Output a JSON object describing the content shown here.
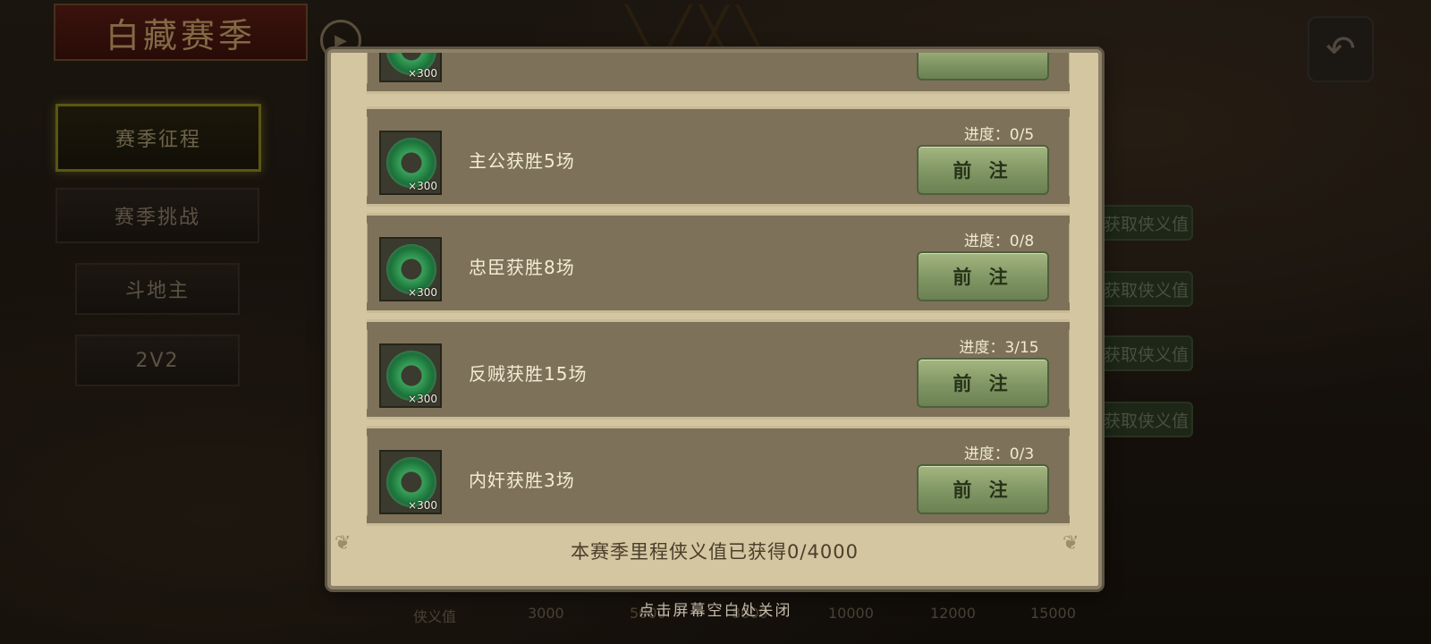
{
  "background": {
    "season_title": "白藏赛季",
    "nav": [
      {
        "label": "赛季征程",
        "active": true
      },
      {
        "label": "赛季挑战",
        "active": false
      },
      {
        "label": "斗地主",
        "active": false
      },
      {
        "label": "2V2",
        "active": false
      }
    ],
    "side_buttons": [
      "获取侠义值",
      "获取侠义值",
      "获取侠义值",
      "获取侠义值"
    ],
    "milestone_label": "侠义值",
    "milestones": [
      "3000",
      "5000",
      "8000",
      "10000",
      "12000",
      "15000"
    ]
  },
  "modal": {
    "tasks": [
      {
        "name": "",
        "reward_qty": "×300",
        "progress": "",
        "button": ""
      },
      {
        "name": "主公获胜5场",
        "reward_qty": "×300",
        "progress": "进度：0/5",
        "button": "前 注"
      },
      {
        "name": "忠臣获胜8场",
        "reward_qty": "×300",
        "progress": "进度：0/8",
        "button": "前 注"
      },
      {
        "name": "反贼获胜15场",
        "reward_qty": "×300",
        "progress": "进度：3/15",
        "button": "前 注"
      },
      {
        "name": "内奸获胜3场",
        "reward_qty": "×300",
        "progress": "进度：0/3",
        "button": "前 注"
      }
    ],
    "footer": "本赛季里程侠义值已获得0/4000"
  },
  "close_hint": "点击屏幕空白处关闭",
  "colors": {
    "jade": "#2e8a4a",
    "button": "#8fa36e",
    "panel": "#d4c6a0",
    "row": "#7d7159"
  }
}
